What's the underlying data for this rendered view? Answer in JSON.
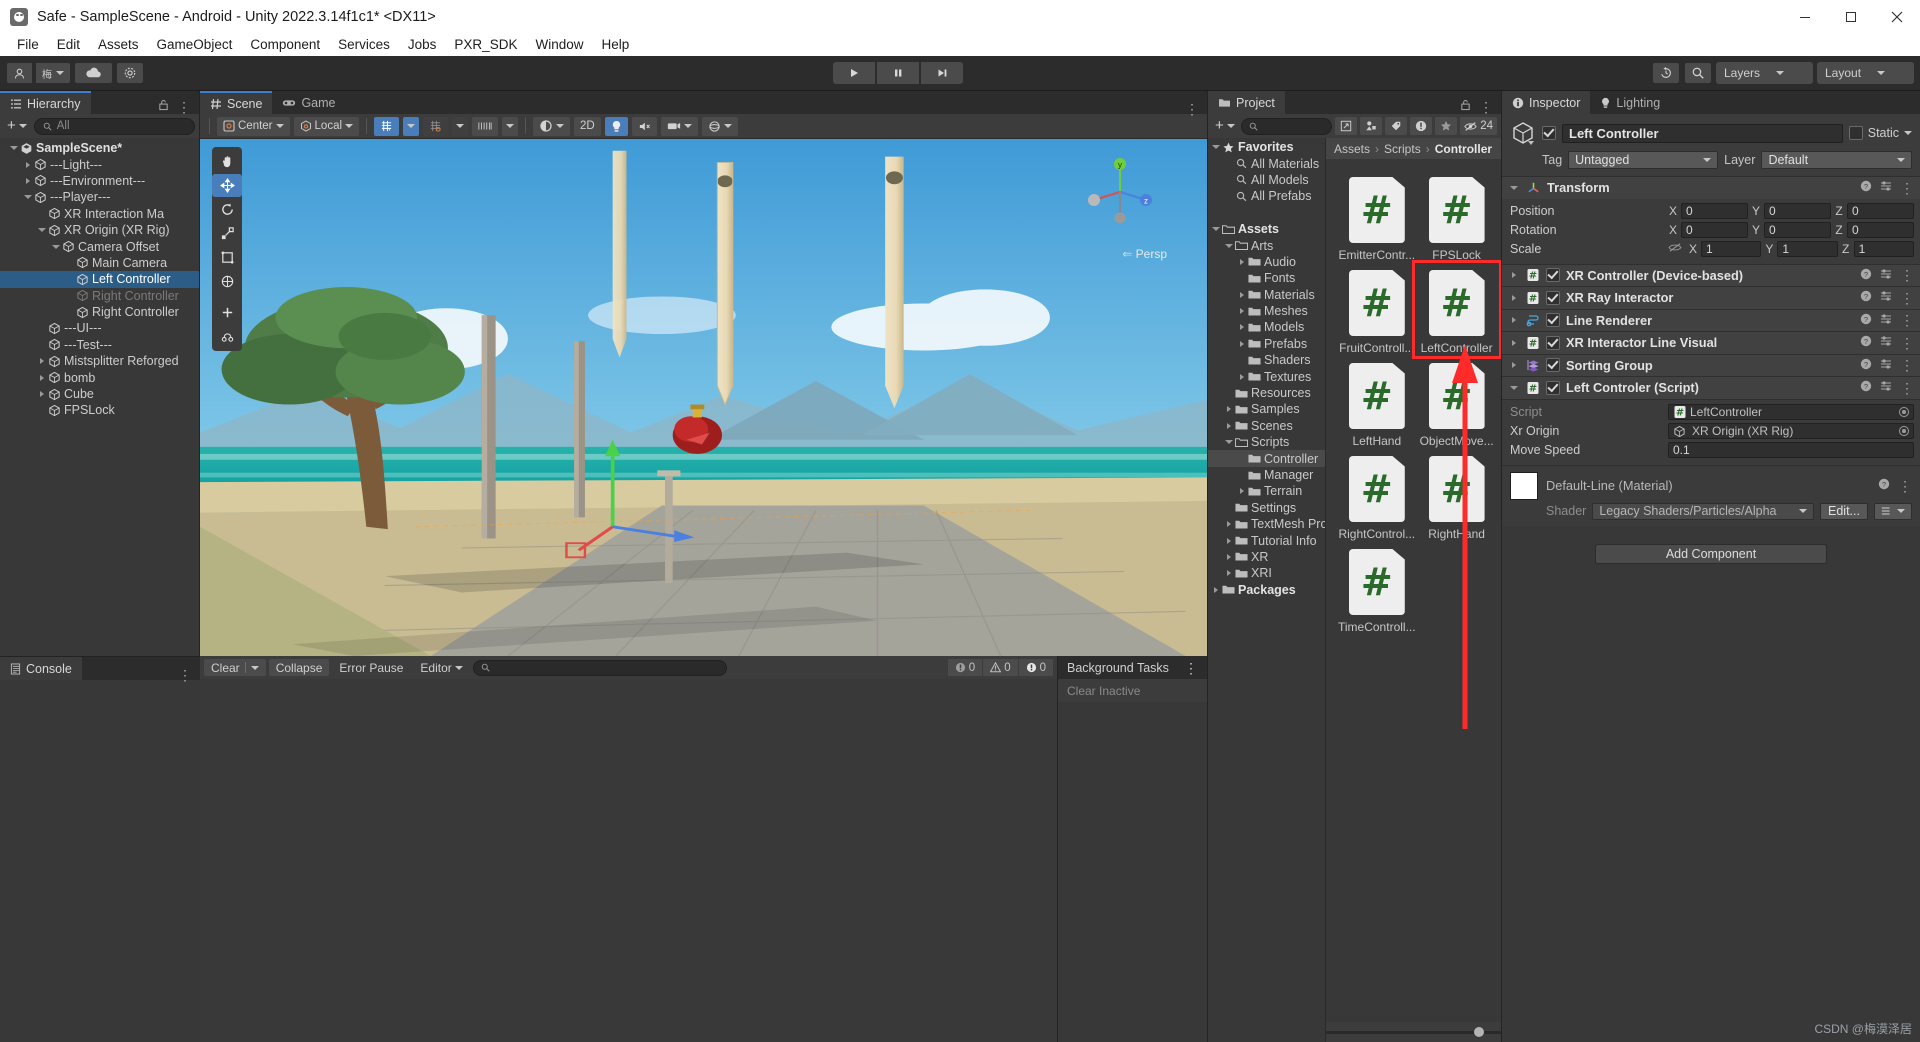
{
  "window": {
    "title": "Safe - SampleScene - Android - Unity 2022.3.14f1c1* <DX11>",
    "minimize": "—",
    "maximize": "☐",
    "close": "✕"
  },
  "menubar": [
    "File",
    "Edit",
    "Assets",
    "GameObject",
    "Component",
    "Services",
    "Jobs",
    "PXR_SDK",
    "Window",
    "Help"
  ],
  "toolbar": {
    "account_icon": "account-icon",
    "cloud_icon": "cloud-icon",
    "settings_icon": "gear-icon",
    "play": "▶",
    "pause": "❚❚",
    "step": "▶|",
    "history_icon": "undo-history-icon",
    "search_icon": "search-icon",
    "layers_label": "Layers",
    "layout_label": "Layout"
  },
  "hierarchy": {
    "tab": "Hierarchy",
    "search_placeholder": "All",
    "add_label": "+",
    "items": [
      {
        "label": "SampleScene*",
        "depth": 0,
        "arrow": "open",
        "icon": "unity-icon",
        "bold": true,
        "selected": false,
        "dim": false
      },
      {
        "label": "---Light---",
        "depth": 1,
        "arrow": "closed",
        "icon": "cube-icon",
        "bold": false,
        "selected": false,
        "dim": false
      },
      {
        "label": "---Environment---",
        "depth": 1,
        "arrow": "closed",
        "icon": "cube-icon",
        "bold": false,
        "selected": false,
        "dim": false
      },
      {
        "label": "---Player---",
        "depth": 1,
        "arrow": "open",
        "icon": "cube-icon",
        "bold": false,
        "selected": false,
        "dim": false
      },
      {
        "label": "XR Interaction Ma",
        "depth": 2,
        "arrow": "none",
        "icon": "cube-icon",
        "bold": false,
        "selected": false,
        "dim": false
      },
      {
        "label": "XR Origin (XR Rig)",
        "depth": 2,
        "arrow": "open",
        "icon": "cube-icon",
        "bold": false,
        "selected": false,
        "dim": false
      },
      {
        "label": "Camera Offset",
        "depth": 3,
        "arrow": "open",
        "icon": "cube-icon",
        "bold": false,
        "selected": false,
        "dim": false
      },
      {
        "label": "Main Camera",
        "depth": 4,
        "arrow": "none",
        "icon": "cube-icon",
        "bold": false,
        "selected": false,
        "dim": false
      },
      {
        "label": "Left Controller",
        "depth": 4,
        "arrow": "none",
        "icon": "cube-icon",
        "bold": false,
        "selected": true,
        "dim": false
      },
      {
        "label": "Right Controller",
        "depth": 4,
        "arrow": "none",
        "icon": "cube-icon",
        "bold": false,
        "selected": false,
        "dim": true
      },
      {
        "label": "Right Controller",
        "depth": 4,
        "arrow": "none",
        "icon": "cube-icon",
        "bold": false,
        "selected": false,
        "dim": false
      },
      {
        "label": "---UI---",
        "depth": 2,
        "arrow": "none",
        "icon": "cube-icon",
        "bold": false,
        "selected": false,
        "dim": false
      },
      {
        "label": "---Test---",
        "depth": 2,
        "arrow": "none",
        "icon": "cube-icon",
        "bold": false,
        "selected": false,
        "dim": false
      },
      {
        "label": "Mistsplitter Reforged",
        "depth": 2,
        "arrow": "closed",
        "icon": "cube-icon",
        "bold": false,
        "selected": false,
        "dim": false
      },
      {
        "label": "bomb",
        "depth": 2,
        "arrow": "closed",
        "icon": "cube-icon",
        "bold": false,
        "selected": false,
        "dim": false
      },
      {
        "label": "Cube",
        "depth": 2,
        "arrow": "closed",
        "icon": "cube-icon",
        "bold": false,
        "selected": false,
        "dim": false
      },
      {
        "label": "FPSLock",
        "depth": 2,
        "arrow": "none",
        "icon": "cube-icon",
        "bold": false,
        "selected": false,
        "dim": false
      }
    ]
  },
  "scene": {
    "tabs": [
      {
        "label": "Scene",
        "icon": "grid-icon",
        "active": true
      },
      {
        "label": "Game",
        "icon": "gamepad-icon",
        "active": false
      }
    ],
    "pivot": "Center",
    "handle_space": "Local",
    "gizmo_label": "▼",
    "toggle_2d": "2D",
    "persp_label": "Persp",
    "axis_x": "x",
    "axis_y": "y",
    "axis_z": "z"
  },
  "console": {
    "tab": "Console",
    "clear": "Clear",
    "collapse": "Collapse",
    "error_pause": "Error Pause",
    "editor": "Editor",
    "search_placeholder": "",
    "log_count": "0",
    "warn_count": "0",
    "error_count": "0"
  },
  "background_tasks": {
    "title": "Background Tasks",
    "clear_inactive": "Clear Inactive"
  },
  "project": {
    "tab": "Project",
    "search_placeholder": "",
    "hidden_count": "24",
    "breadcrumb": [
      "Assets",
      "Scripts",
      "Controller"
    ],
    "tree": [
      {
        "label": "Favorites",
        "depth": 0,
        "arrow": "open",
        "icon": "star-icon",
        "bold": true
      },
      {
        "label": "All Materials",
        "depth": 1,
        "arrow": "none",
        "icon": "search-icon",
        "bold": false
      },
      {
        "label": "All Models",
        "depth": 1,
        "arrow": "none",
        "icon": "search-icon",
        "bold": false
      },
      {
        "label": "All Prefabs",
        "depth": 1,
        "arrow": "none",
        "icon": "search-icon",
        "bold": false
      },
      {
        "label": "",
        "depth": 0,
        "arrow": "none",
        "icon": "none",
        "bold": false
      },
      {
        "label": "Assets",
        "depth": 0,
        "arrow": "open",
        "icon": "folder-open-icon",
        "bold": true
      },
      {
        "label": "Arts",
        "depth": 1,
        "arrow": "open",
        "icon": "folder-open-icon",
        "bold": false
      },
      {
        "label": "Audio",
        "depth": 2,
        "arrow": "closed",
        "icon": "folder-icon",
        "bold": false
      },
      {
        "label": "Fonts",
        "depth": 2,
        "arrow": "none",
        "icon": "folder-icon",
        "bold": false
      },
      {
        "label": "Materials",
        "depth": 2,
        "arrow": "closed",
        "icon": "folder-icon",
        "bold": false
      },
      {
        "label": "Meshes",
        "depth": 2,
        "arrow": "closed",
        "icon": "folder-icon",
        "bold": false
      },
      {
        "label": "Models",
        "depth": 2,
        "arrow": "closed",
        "icon": "folder-icon",
        "bold": false
      },
      {
        "label": "Prefabs",
        "depth": 2,
        "arrow": "closed",
        "icon": "folder-icon",
        "bold": false
      },
      {
        "label": "Shaders",
        "depth": 2,
        "arrow": "none",
        "icon": "folder-icon",
        "bold": false
      },
      {
        "label": "Textures",
        "depth": 2,
        "arrow": "closed",
        "icon": "folder-icon",
        "bold": false
      },
      {
        "label": "Resources",
        "depth": 1,
        "arrow": "none",
        "icon": "folder-icon",
        "bold": false
      },
      {
        "label": "Samples",
        "depth": 1,
        "arrow": "closed",
        "icon": "folder-icon",
        "bold": false
      },
      {
        "label": "Scenes",
        "depth": 1,
        "arrow": "closed",
        "icon": "folder-icon",
        "bold": false
      },
      {
        "label": "Scripts",
        "depth": 1,
        "arrow": "open",
        "icon": "folder-open-icon",
        "bold": false
      },
      {
        "label": "Controller",
        "depth": 2,
        "arrow": "none",
        "icon": "folder-icon",
        "bold": false,
        "selected": true
      },
      {
        "label": "Manager",
        "depth": 2,
        "arrow": "none",
        "icon": "folder-icon",
        "bold": false
      },
      {
        "label": "Terrain",
        "depth": 2,
        "arrow": "closed",
        "icon": "folder-icon",
        "bold": false
      },
      {
        "label": "Settings",
        "depth": 1,
        "arrow": "none",
        "icon": "folder-icon",
        "bold": false
      },
      {
        "label": "TextMesh Pro",
        "depth": 1,
        "arrow": "closed",
        "icon": "folder-icon",
        "bold": false
      },
      {
        "label": "Tutorial Info",
        "depth": 1,
        "arrow": "closed",
        "icon": "folder-icon",
        "bold": false
      },
      {
        "label": "XR",
        "depth": 1,
        "arrow": "closed",
        "icon": "folder-icon",
        "bold": false
      },
      {
        "label": "XRI",
        "depth": 1,
        "arrow": "closed",
        "icon": "folder-icon",
        "bold": false
      },
      {
        "label": "Packages",
        "depth": 0,
        "arrow": "closed",
        "icon": "folder-icon",
        "bold": true
      }
    ],
    "assets": [
      {
        "label": "EmitterContr...",
        "highlighted": false
      },
      {
        "label": "FPSLock",
        "highlighted": false
      },
      {
        "label": "FruitControll...",
        "highlighted": false
      },
      {
        "label": "LeftController",
        "highlighted": true
      },
      {
        "label": "LeftHand",
        "highlighted": false
      },
      {
        "label": "ObjectMove...",
        "highlighted": false
      },
      {
        "label": "RightControl...",
        "highlighted": false
      },
      {
        "label": "RightHand",
        "highlighted": false
      },
      {
        "label": "TimeControll...",
        "highlighted": false
      }
    ]
  },
  "inspector": {
    "tabs": [
      {
        "label": "Inspector",
        "icon": "info-icon",
        "active": true
      },
      {
        "label": "Lighting",
        "icon": "bulb-icon",
        "active": false
      }
    ],
    "object_name": "Left Controller",
    "enabled": true,
    "static_label": "Static",
    "tag_label": "Tag",
    "tag_value": "Untagged",
    "layer_label": "Layer",
    "layer_value": "Default",
    "transform": {
      "title": "Transform",
      "rows": [
        {
          "name": "Position",
          "x": "0",
          "y": "0",
          "z": "0"
        },
        {
          "name": "Rotation",
          "x": "0",
          "y": "0",
          "z": "0"
        },
        {
          "name": "Scale",
          "x": "1",
          "y": "1",
          "z": "1"
        }
      ],
      "axis_labels": [
        "X",
        "Y",
        "Z"
      ]
    },
    "components": [
      {
        "title": "XR Controller (Device-based)",
        "icon": "cs-script-icon",
        "expanded": false,
        "enabled": true
      },
      {
        "title": "XR Ray Interactor",
        "icon": "cs-script-icon",
        "expanded": false,
        "enabled": true
      },
      {
        "title": "Line Renderer",
        "icon": "line-renderer-icon",
        "expanded": false,
        "enabled": true
      },
      {
        "title": "XR Interactor Line Visual",
        "icon": "cs-script-icon",
        "expanded": false,
        "enabled": true
      },
      {
        "title": "Sorting Group",
        "icon": "sorting-group-icon",
        "expanded": false,
        "enabled": true
      },
      {
        "title": "Left Controler (Script)",
        "icon": "cs-script-icon",
        "expanded": true,
        "enabled": true
      }
    ],
    "script_props": [
      {
        "name": "Script",
        "value": "LeftController",
        "type": "object",
        "icon": "cs-script-icon",
        "dim": true
      },
      {
        "name": "Xr Origin",
        "value": "XR Origin (XR Rig)",
        "type": "object",
        "icon": "cube-icon",
        "dim": false
      },
      {
        "name": "Move Speed",
        "value": "0.1",
        "type": "text",
        "dim": false
      }
    ],
    "material": {
      "title": "Default-Line (Material)",
      "shader_label": "Shader",
      "shader_value": "Legacy Shaders/Particles/Alpha",
      "edit_label": "Edit..."
    },
    "add_component": "Add Component"
  },
  "watermark": "CSDN @梅漠泽居",
  "colors": {
    "accent_blue": "#3f7fd0",
    "selection_blue": "#2c5d87",
    "highlight_red": "#ff2b2b",
    "panel_bg": "#383838",
    "header_bg": "#2c2c2c"
  }
}
